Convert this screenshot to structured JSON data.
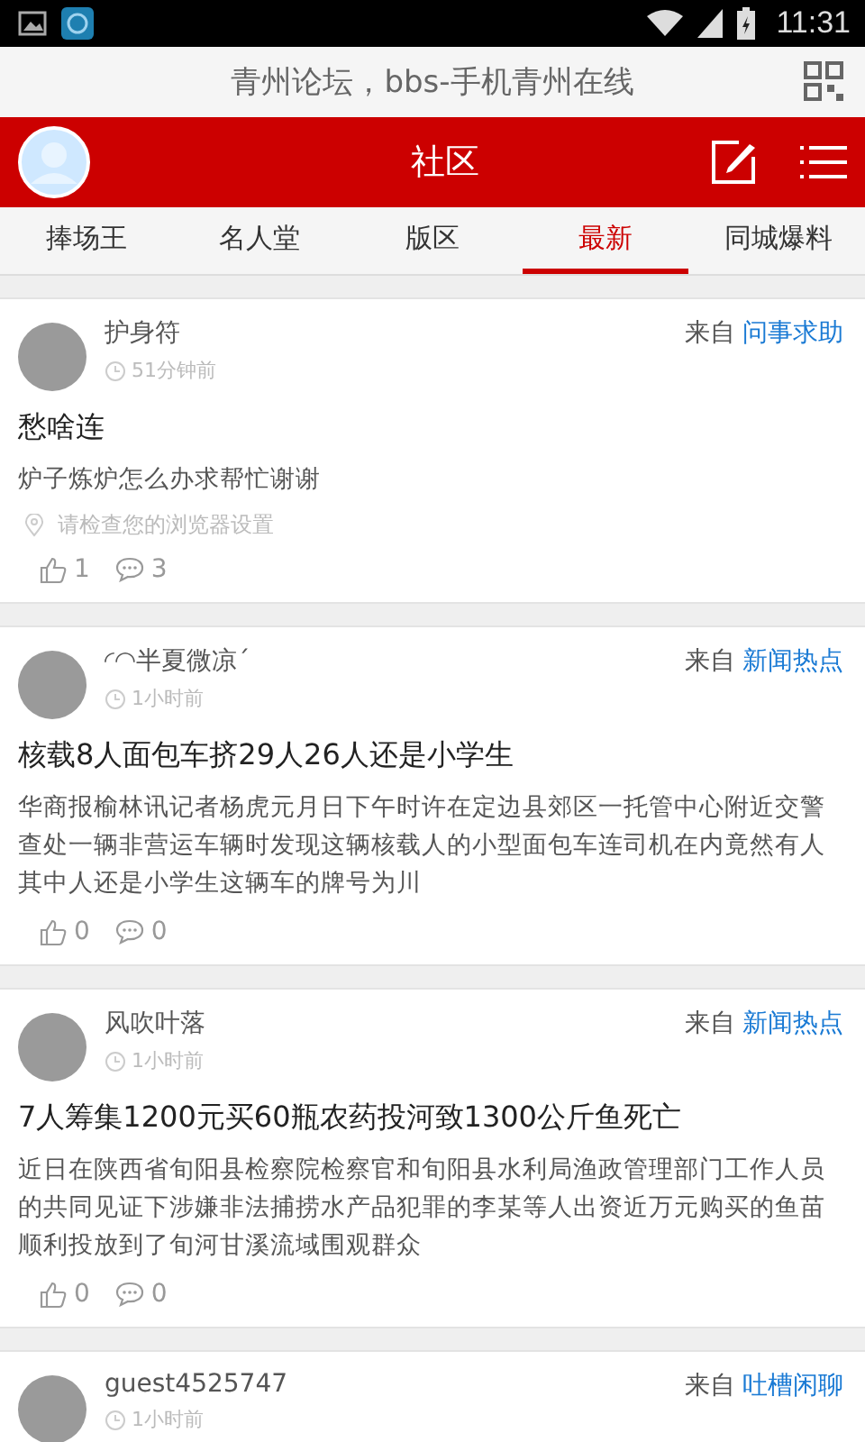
{
  "status_bar": {
    "time": "11:31"
  },
  "site_bar": {
    "title": "青州论坛，bbs-手机青州在线"
  },
  "header": {
    "title": "社区"
  },
  "tabs": [
    {
      "label": "捧场王",
      "selected": false
    },
    {
      "label": "名人堂",
      "selected": false
    },
    {
      "label": "版区",
      "selected": false
    },
    {
      "label": "最新",
      "selected": true
    },
    {
      "label": "同城爆料",
      "selected": false
    }
  ],
  "posts": [
    {
      "author": "护身符",
      "time": "51分钟前",
      "from_label": "来自",
      "forum": "问事求助",
      "title": "愁啥连",
      "body": "炉子炼炉怎么办求帮忙谢谢",
      "location": "请检查您的浏览器设置",
      "likes": "1",
      "comments": "3"
    },
    {
      "author": "◜◠半夏微凉´",
      "time": "1小时前",
      "from_label": "来自",
      "forum": "新闻热点",
      "title": "核载8人面包车挤29人26人还是小学生",
      "body": "华商报榆林讯记者杨虎元月日下午时许在定边县郊区一托管中心附近交警查处一辆非营运车辆时发现这辆核载人的小型面包车连司机在内竟然有人其中人还是小学生这辆车的牌号为川",
      "likes": "0",
      "comments": "0"
    },
    {
      "author": "风吹叶落",
      "time": "1小时前",
      "from_label": "来自",
      "forum": "新闻热点",
      "title": "7人筹集1200元买60瓶农药投河致1300公斤鱼死亡",
      "body": "近日在陕西省旬阳县检察院检察官和旬阳县水利局渔政管理部门工作人员的共同见证下涉嫌非法捕捞水产品犯罪的李某等人出资近万元购买的鱼苗顺利投放到了旬河甘溪流域围观群众",
      "likes": "0",
      "comments": "0"
    },
    {
      "author": "guest4525747",
      "time": "1小时前",
      "from_label": "来自",
      "forum": "吐槽闲聊"
    }
  ]
}
